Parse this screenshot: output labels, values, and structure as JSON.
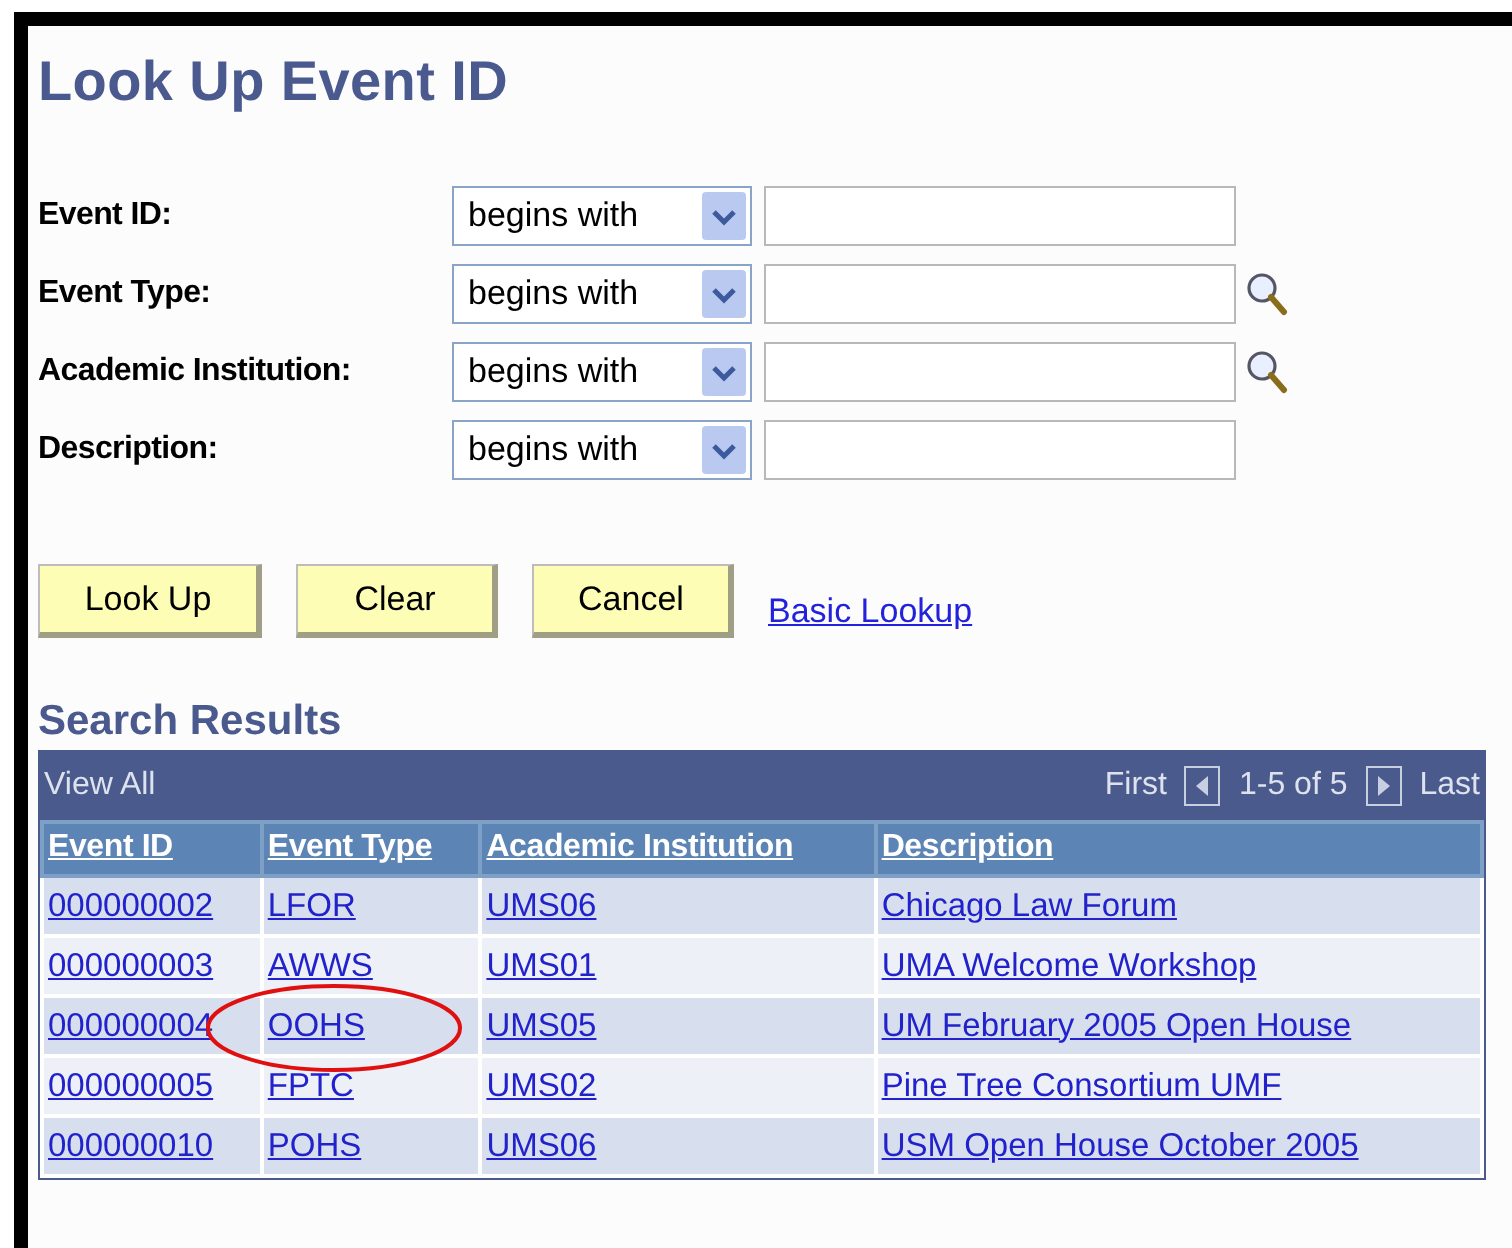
{
  "title": "Look Up Event ID",
  "criteria": [
    {
      "label": "Event ID:",
      "operator": "begins with",
      "lookup": false
    },
    {
      "label": "Event Type:",
      "operator": "begins with",
      "lookup": true
    },
    {
      "label": "Academic Institution:",
      "operator": "begins with",
      "lookup": true
    },
    {
      "label": "Description:",
      "operator": "begins with",
      "lookup": false
    }
  ],
  "buttons": [
    "Look Up",
    "Clear",
    "Cancel"
  ],
  "basic_lookup_link": "Basic Lookup",
  "results": {
    "title": "Search Results",
    "view_all": "View All",
    "first": "First",
    "range": "1-5 of 5",
    "last": "Last",
    "columns": [
      "Event ID",
      "Event Type",
      "Academic Institution",
      "Description"
    ],
    "rows": [
      {
        "cells": [
          "000000002",
          "LFOR",
          "UMS06",
          "Chicago Law Forum"
        ],
        "circled": false
      },
      {
        "cells": [
          "000000003",
          "AWWS",
          "UMS01",
          "UMA Welcome Workshop"
        ],
        "circled": false
      },
      {
        "cells": [
          "000000004",
          "OOHS",
          "UMS05",
          "UM February 2005 Open House"
        ],
        "circled": true
      },
      {
        "cells": [
          "000000005",
          "FPTC",
          "UMS02",
          "Pine Tree Consortium UMF"
        ],
        "circled": false
      },
      {
        "cells": [
          "000000010",
          "POHS",
          "UMS06",
          "USM Open House October 2005"
        ],
        "circled": false
      }
    ]
  }
}
